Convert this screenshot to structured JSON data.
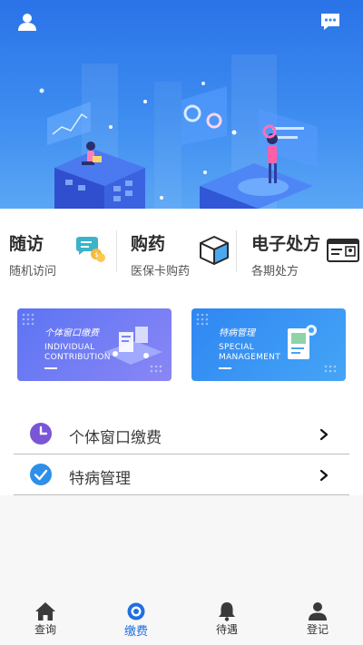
{
  "header": {
    "user_icon": "user-icon",
    "chat_icon": "chat-bubble-icon",
    "background_color": "#2a73e8"
  },
  "quick_actions": [
    {
      "title": "随访",
      "subtitle": "随机访问",
      "icon": "chat-coins-icon"
    },
    {
      "title": "购药",
      "subtitle": "医保卡购药",
      "icon": "box-icon"
    },
    {
      "title": "电子处方",
      "subtitle": "各期处方",
      "icon": "id-card-icon"
    }
  ],
  "banners": [
    {
      "title_cn": "个体窗口缴费",
      "title_en_line1": "INDIVIDUAL",
      "title_en_line2": "CONTRIBUTION",
      "color": "#6a78f3"
    },
    {
      "title_cn": "特病管理",
      "title_en_line1": "SPECIAL",
      "title_en_line2": "MANAGEMENT",
      "color": "#3690f3"
    }
  ],
  "menu": [
    {
      "label": "个体窗口缴费",
      "icon": "clock-icon",
      "icon_color": "#7a55d6"
    },
    {
      "label": "特病管理",
      "icon": "check-circle-icon",
      "icon_color": "#2f8fe8"
    }
  ],
  "tabbar": {
    "active_color": "#1f6fe0",
    "items": [
      {
        "label": "查询",
        "icon": "home-icon",
        "active": false
      },
      {
        "label": "缴费",
        "icon": "circle-target-icon",
        "active": true
      },
      {
        "label": "待遇",
        "icon": "bell-icon",
        "active": false
      },
      {
        "label": "登记",
        "icon": "person-icon",
        "active": false
      }
    ]
  }
}
